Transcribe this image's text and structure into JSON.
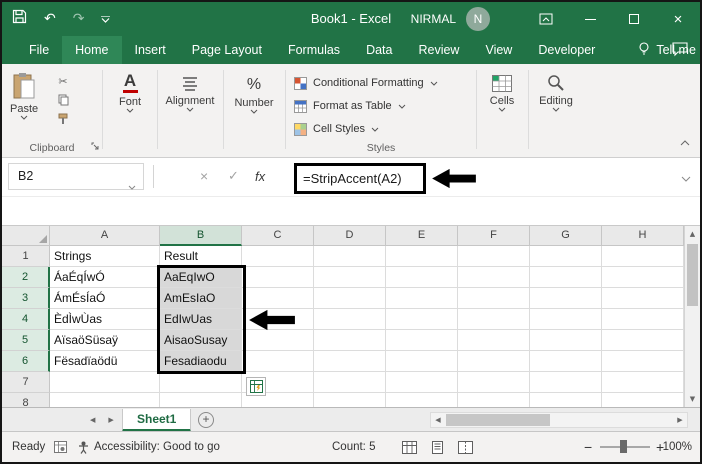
{
  "theme": {
    "accent": "#217346",
    "selection_fill": "#d8d8d8"
  },
  "window": {
    "title": "Book1 - Excel",
    "user": "NIRMAL",
    "avatar": "N"
  },
  "icons": {
    "undo": "↶",
    "redo": "↷",
    "cut": "✂",
    "font_a": "A",
    "percent": "%",
    "fx": "fx",
    "cancel": "×",
    "enter": "✓",
    "close": "×",
    "tri_up": "▲",
    "tri_down": "▼",
    "tri_left": "◀",
    "tri_right": "▶",
    "plus": "+",
    "zoom_out": "−",
    "zoom_in": "+"
  },
  "ribbon_tabs": [
    "File",
    "Home",
    "Insert",
    "Page Layout",
    "Formulas",
    "Data",
    "Review",
    "View",
    "Developer"
  ],
  "tell_me": "Tell me",
  "ribbon": {
    "paste_label": "Paste",
    "clipboard_label": "Clipboard",
    "font_label": "Font",
    "alignment_label": "Alignment",
    "number_label": "Number",
    "styles_items": [
      "Conditional Formatting",
      "Format as Table",
      "Cell Styles"
    ],
    "styles_label": "Styles",
    "cells_label": "Cells",
    "editing_label": "Editing"
  },
  "formula_bar": {
    "name_box": "B2",
    "formula": "=StripAccent(A2)"
  },
  "sheet": {
    "col_headers": [
      "A",
      "B",
      "C",
      "D",
      "E",
      "F",
      "G",
      "H"
    ],
    "row_headers": [
      "1",
      "2",
      "3",
      "4",
      "5",
      "6",
      "7",
      "8"
    ],
    "rows": [
      {
        "A": "Strings",
        "B": "Result"
      },
      {
        "A": "ÁaÉqÍwÓ",
        "B": "AaEqIwO"
      },
      {
        "A": "ÁmÉsÍaÓ",
        "B": "AmEsIaO"
      },
      {
        "A": "ÈdÌwÙas",
        "B": "EdIwUas"
      },
      {
        "A": "AïsaöSüsaÿ",
        "B": "AisaoSusay"
      },
      {
        "A": "Fësadïaödü",
        "B": "Fesadiaodu"
      },
      {},
      {}
    ]
  },
  "selection": {
    "active_cell": "B2",
    "column": "B",
    "rows": [
      "2",
      "3",
      "4",
      "5",
      "6"
    ]
  },
  "sheet_tabs": {
    "active": "Sheet1"
  },
  "status": {
    "ready": "Ready",
    "accessibility": "Accessibility: Good to go",
    "count": "Count: 5",
    "zoom": "100%"
  }
}
